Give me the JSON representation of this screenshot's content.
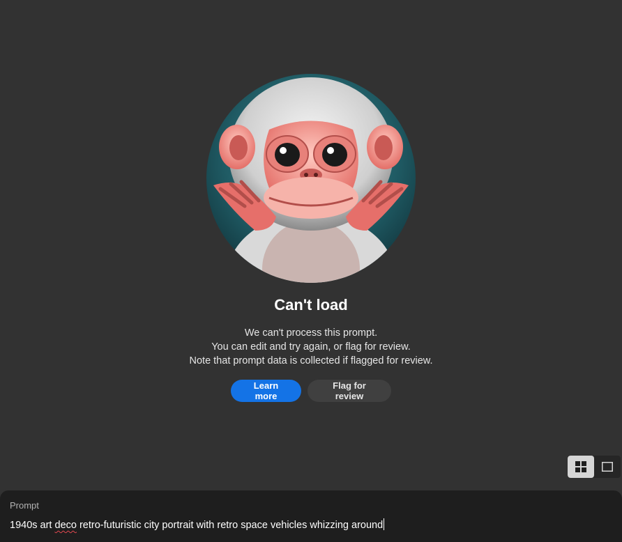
{
  "error": {
    "title": "Can't load",
    "message_lines": [
      "We can't process this prompt.",
      "You can edit and try again, or flag for review.",
      "Note that prompt data is collected if flagged for review."
    ],
    "illustration_icon": "monkey-illustration-icon"
  },
  "actions": {
    "learn_more_label": "Learn more",
    "flag_label": "Flag for review"
  },
  "view_toggle": {
    "options": [
      "grid-view-icon",
      "single-view-icon"
    ],
    "active": "grid-view-icon"
  },
  "prompt": {
    "label": "Prompt",
    "value_before": "1940s art ",
    "value_misspelled": "deco",
    "value_after": " retro-futuristic city portrait with retro space vehicles whizzing around"
  },
  "colors": {
    "background": "#323232",
    "primary_button": "#1473e6",
    "secondary_button": "#404040",
    "prompt_panel": "#1e1e1e"
  }
}
